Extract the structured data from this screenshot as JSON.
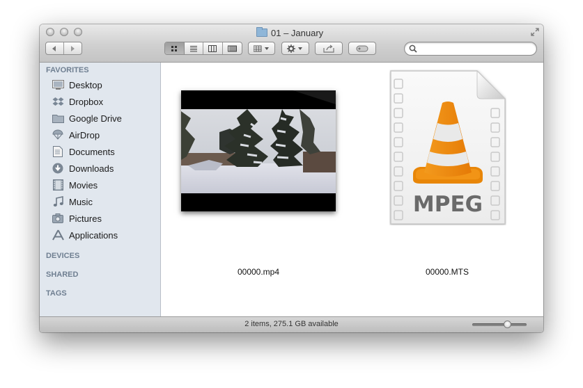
{
  "window": {
    "title": "01 – January"
  },
  "toolbar": {
    "view_buttons": [
      "icon-view",
      "list-view",
      "column-view",
      "cover-flow-view"
    ],
    "search": {
      "value": "",
      "placeholder": ""
    }
  },
  "sidebar": {
    "favorites_header": "FAVORITES",
    "items": [
      {
        "label": "Desktop",
        "icon": "desktop-icon"
      },
      {
        "label": "Dropbox",
        "icon": "dropbox-icon"
      },
      {
        "label": "Google Drive",
        "icon": "folder-icon"
      },
      {
        "label": "AirDrop",
        "icon": "airdrop-icon"
      },
      {
        "label": "Documents",
        "icon": "documents-icon"
      },
      {
        "label": "Downloads",
        "icon": "downloads-icon"
      },
      {
        "label": "Movies",
        "icon": "movies-icon"
      },
      {
        "label": "Music",
        "icon": "music-icon"
      },
      {
        "label": "Pictures",
        "icon": "pictures-icon"
      },
      {
        "label": "Applications",
        "icon": "applications-icon"
      }
    ],
    "devices_header": "DEVICES",
    "shared_header": "SHARED",
    "tags_header": "TAGS"
  },
  "files": [
    {
      "name": "00000.mp4",
      "kind": "video-thumbnail"
    },
    {
      "name": "00000.MTS",
      "kind": "vlc-mpeg-document",
      "badge": "MPEG"
    }
  ],
  "status": {
    "text": "2 items, 275.1 GB available",
    "zoom_level": 0.65
  },
  "colors": {
    "vlc_orange": "#f08a0c",
    "sidebar_bg": "#e1e7ee"
  }
}
